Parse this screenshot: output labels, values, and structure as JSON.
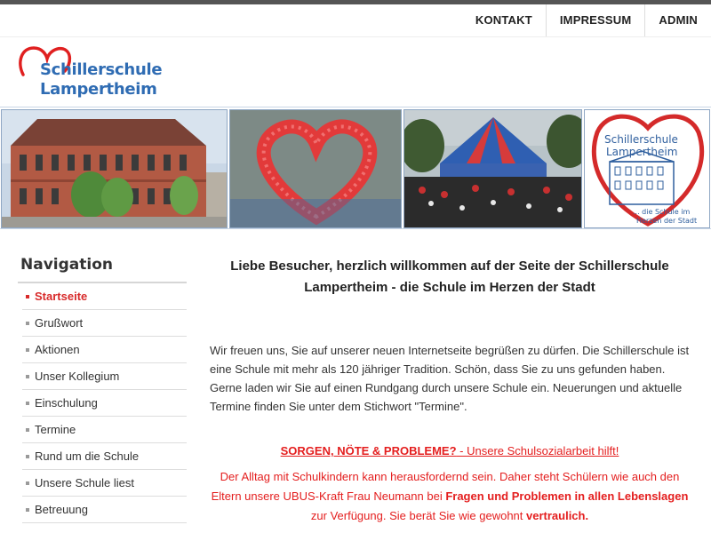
{
  "topnav": {
    "items": [
      "KONTAKT",
      "IMPRESSUM",
      "ADMIN"
    ]
  },
  "logo": {
    "line1": "Schillerschule",
    "line2": "Lampertheim",
    "heart_color": "#e02020",
    "text_color": "#2f6cb3"
  },
  "banner": {
    "logo_caption_line1": "Schillerschule",
    "logo_caption_line2": "Lampertheim",
    "logo_tagline_line1": "... die Schule im",
    "logo_tagline_line2": "Herzen der Stadt"
  },
  "sidebar": {
    "title": "Navigation",
    "items": [
      "Startseite",
      "Grußwort",
      "Aktionen",
      "Unser Kollegium",
      "Einschulung",
      "Termine",
      "Rund um die Schule",
      "Unsere Schule liest",
      "Betreuung"
    ],
    "active_index": 0
  },
  "main": {
    "welcome": "Liebe Besucher, herzlich willkommen auf der Seite der Schillerschule Lampertheim - die Schule im Herzen der Stadt",
    "intro": "Wir freuen uns, Sie auf unserer neuen Internetseite begrüßen zu dürfen. Die Schillerschule ist eine Schule mit mehr als 120 jähriger Tradition. Schön, dass Sie zu uns gefunden haben. Gerne laden wir Sie auf einen Rundgang durch unsere Schule ein. Neuerungen und aktuelle Termine finden Sie unter dem Stichwort \"Termine\".",
    "sorgen_title": "SORGEN, NÖTE & PROBLEME?",
    "sorgen_link": " - Unsere Schulsozialarbeit hilft!",
    "alltag_1": "Der Alltag mit Schulkindern kann herausfordernd sein. Daher steht Schülern wie auch den Eltern unsere UBUS-Kraft Frau Neumann bei ",
    "alltag_bold1": "Fragen und Problemen in allen Lebenslagen",
    "alltag_2": " zur Verfügung. Sie berät Sie wie gewohnt ",
    "alltag_bold2": "vertraulich."
  },
  "colors": {
    "accent_red": "#e41e1e",
    "nav_active": "#d82a2a",
    "brand_blue": "#2f6cb3"
  }
}
